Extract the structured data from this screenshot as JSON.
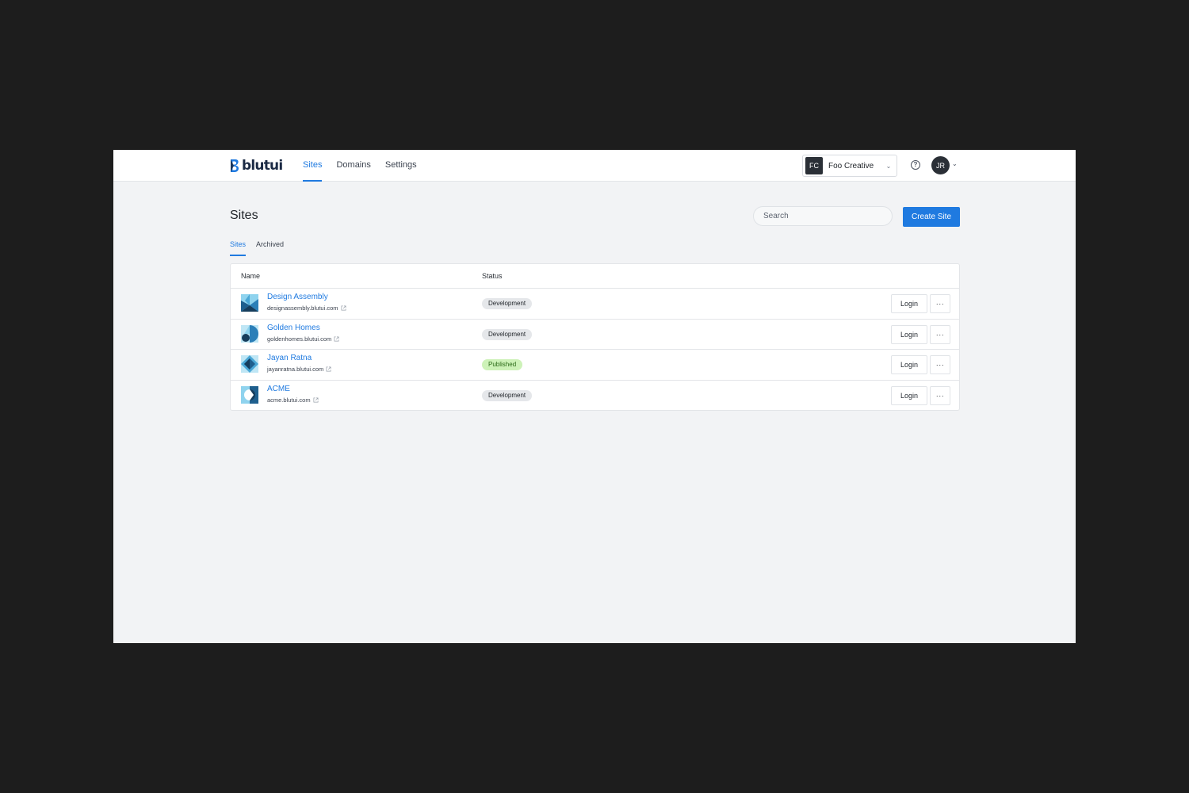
{
  "brand": {
    "name": "blutui",
    "accent": "#1f7ae0",
    "logo_icon": "blutui-logo-icon"
  },
  "nav": {
    "items": [
      {
        "label": "Sites",
        "active": true
      },
      {
        "label": "Domains",
        "active": false
      },
      {
        "label": "Settings",
        "active": false
      }
    ]
  },
  "org": {
    "initials": "FC",
    "name": "Foo Creative",
    "chevron": "⌄"
  },
  "help_icon": "?",
  "user": {
    "initials": "JR",
    "chevron": "⌄"
  },
  "page": {
    "title": "Sites",
    "search_placeholder": "Search",
    "create_label": "Create Site"
  },
  "tabs": [
    {
      "label": "Sites",
      "active": true
    },
    {
      "label": "Archived",
      "active": false
    }
  ],
  "table": {
    "columns": {
      "name": "Name",
      "status": "Status"
    },
    "rows": [
      {
        "name": "Design Assembly",
        "url": "designassembly.blutui.com",
        "status": "Development",
        "status_kind": "dev",
        "icon": "design-assembly-logo-icon",
        "login": "Login",
        "more": "···"
      },
      {
        "name": "Golden Homes",
        "url": "goldenhomes.blutui.com",
        "status": "Development",
        "status_kind": "dev",
        "icon": "golden-homes-logo-icon",
        "login": "Login",
        "more": "···"
      },
      {
        "name": "Jayan Ratna",
        "url": "jayanratna.blutui.com",
        "status": "Published",
        "status_kind": "pub",
        "icon": "jayan-ratna-logo-icon",
        "login": "Login",
        "more": "···"
      },
      {
        "name": "ACME",
        "url": "acme.blutui.com",
        "status": "Development",
        "status_kind": "dev",
        "icon": "acme-logo-icon",
        "login": "Login",
        "more": "···"
      }
    ]
  },
  "colors": {
    "status_development_bg": "#e5e7ea",
    "status_published_bg": "#cdf2b8",
    "primary_button": "#1f7ae0"
  }
}
